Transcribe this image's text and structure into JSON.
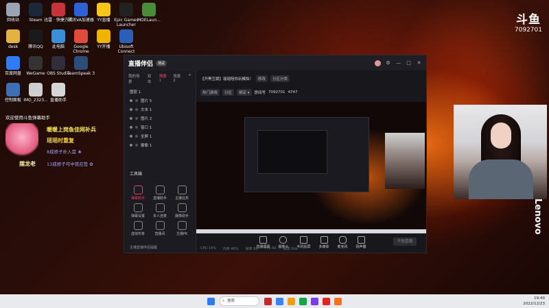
{
  "desktop": {
    "icons": [
      {
        "label": "回收站",
        "color": "#9aa4b5"
      },
      {
        "label": "Steam",
        "color": "#1b2838"
      },
      {
        "label": "迅雷 · 快捷方式",
        "color": "#c8323a"
      },
      {
        "label": "腾讯VA加速器",
        "color": "#2d62d6"
      },
      {
        "label": "YY直播",
        "color": "#f5c518"
      },
      {
        "label": "Epic Games Launcher",
        "color": "#222222"
      },
      {
        "label": "MOELaun...",
        "color": "#4a8c3a"
      },
      {
        "label": "desk",
        "color": "#e3b341"
      },
      {
        "label": "腾讯QQ",
        "color": "#1a1a1a"
      },
      {
        "label": "此电脑",
        "color": "#3a8fd9"
      },
      {
        "label": "Google Chrome",
        "color": "#e04b3c"
      },
      {
        "label": "YY开播",
        "color": "#f0b400"
      },
      {
        "label": "Ubisoft Connect",
        "color": "#2b5fb8"
      },
      {
        "label": "百度网盘",
        "color": "#2f7df6"
      },
      {
        "label": "WeGame",
        "color": "#333333"
      },
      {
        "label": "OBS Studio",
        "color": "#302e3d"
      },
      {
        "label": "TeamSpeak 3",
        "color": "#2a4d7a"
      },
      {
        "label": "控制面板",
        "color": "#3c6fb5"
      },
      {
        "label": "IMG_2323...",
        "color": "#cfcfcf"
      },
      {
        "label": "直播助手",
        "color": "#d6d6d6"
      }
    ]
  },
  "danmaku": [
    {
      "text": "欢迎使用斗鱼弹幕助手",
      "color": "#ffffff"
    },
    {
      "text": "暖暖上岗鱼佳网补兵",
      "color": "#ffe95a"
    },
    {
      "text": "瑶瑶时重复",
      "color": "#ffd23a"
    },
    {
      "text": "8成桥子扑入首 ❀",
      "color": "#b7a8ff"
    },
    {
      "text": "摆龙老",
      "color": "#fff19a"
    },
    {
      "text": "13成桥子可中铁应签 ✿",
      "color": "#b7a8ff"
    }
  ],
  "app": {
    "logo_text": "直播伴侣",
    "logo_badge": "测试",
    "window_buttons": [
      "—",
      "□",
      "✕"
    ],
    "left_tabs": [
      "我的场景",
      "双击",
      "场景1",
      "场景 2"
    ],
    "active_tab_index": 2,
    "add_scene": "+",
    "layer_header": "图层 1",
    "layers": [
      "图片 5",
      "文本 1",
      "图片 2",
      "窗口 1",
      "全屏 1",
      "摄像 1"
    ],
    "tools_title": "工具箱",
    "tools": [
      {
        "label": "弹幕助手",
        "active": true
      },
      {
        "label": "直播助手",
        "active": false
      },
      {
        "label": "主播任务",
        "active": false
      },
      {
        "label": "弹幕设置",
        "active": false
      },
      {
        "label": "多人连麦",
        "active": false
      },
      {
        "label": "摄像助手",
        "active": false
      },
      {
        "label": "虚拟形象",
        "active": false
      },
      {
        "label": "直播间",
        "active": false
      },
      {
        "label": "主播PK",
        "active": false
      }
    ],
    "left_footer": "主播直播伴侣提醒",
    "room_title": "【开黑互娱】瑶瑶陪你玩模拟！",
    "room_edit": "修改",
    "room_category": "分区分类",
    "chips": [
      "热门游戏",
      "分区",
      "绑定 ▾"
    ],
    "room_id_label": "房间号",
    "room_id": "7092701",
    "viewers": "4747",
    "bottom_buttons": [
      "直播屏幕",
      "摄像头",
      "手机投屏",
      "多媒体",
      "麦克风",
      "扬声器"
    ],
    "start_button": "开始直播",
    "status_items": [
      "CPU 14%",
      "内存 46%",
      "帧率 60",
      "FPS 60",
      "码率 0kb"
    ]
  },
  "overlay": {
    "brand": "斗鱼",
    "room_id": "7092701",
    "lenovo": "Lenovo"
  },
  "taskbar": {
    "search_placeholder": "搜索",
    "time": "19:40",
    "date": "2022/12/23",
    "app_colors": [
      "#c62828",
      "#3b82f6",
      "#f59e0b",
      "#16a34a",
      "#7c3aed",
      "#dc2626",
      "#f97316"
    ]
  }
}
